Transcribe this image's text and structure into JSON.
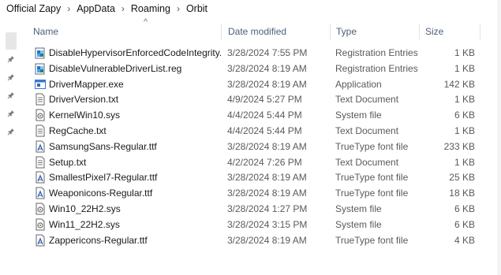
{
  "breadcrumb": [
    "Official Zapy",
    "AppData",
    "Roaming",
    "Orbit"
  ],
  "breadcrumb_separator": "›",
  "columns": {
    "name": "Name",
    "date": "Date modified",
    "type": "Type",
    "size": "Size",
    "sort_indicator": "^"
  },
  "files": [
    {
      "name": "DisableHypervisorEnforcedCodeIntegrity....",
      "date": "3/28/2024 7:55 PM",
      "type": "Registration Entries",
      "size": "1 KB",
      "icon": "registry-icon"
    },
    {
      "name": "DisableVulnerableDriverList.reg",
      "date": "3/28/2024 8:19 AM",
      "type": "Registration Entries",
      "size": "1 KB",
      "icon": "registry-icon"
    },
    {
      "name": "DriverMapper.exe",
      "date": "3/28/2024 8:19 AM",
      "type": "Application",
      "size": "142 KB",
      "icon": "application-icon"
    },
    {
      "name": "DriverVersion.txt",
      "date": "4/9/2024 5:27 PM",
      "type": "Text Document",
      "size": "1 KB",
      "icon": "text-document-icon"
    },
    {
      "name": "KernelWin10.sys",
      "date": "4/4/2024 5:44 PM",
      "type": "System file",
      "size": "6 KB",
      "icon": "system-file-icon"
    },
    {
      "name": "RegCache.txt",
      "date": "4/4/2024 5:44 PM",
      "type": "Text Document",
      "size": "1 KB",
      "icon": "text-document-icon"
    },
    {
      "name": "SamsungSans-Regular.ttf",
      "date": "3/28/2024 8:19 AM",
      "type": "TrueType font file",
      "size": "233 KB",
      "icon": "font-file-icon"
    },
    {
      "name": "Setup.txt",
      "date": "4/2/2024 7:26 PM",
      "type": "Text Document",
      "size": "1 KB",
      "icon": "text-document-icon"
    },
    {
      "name": "SmallestPixel7-Regular.ttf",
      "date": "3/28/2024 8:19 AM",
      "type": "TrueType font file",
      "size": "25 KB",
      "icon": "font-file-icon"
    },
    {
      "name": "Weaponicons-Regular.ttf",
      "date": "3/28/2024 8:19 AM",
      "type": "TrueType font file",
      "size": "18 KB",
      "icon": "font-file-icon"
    },
    {
      "name": "Win10_22H2.sys",
      "date": "3/28/2024 1:27 PM",
      "type": "System file",
      "size": "6 KB",
      "icon": "system-file-icon"
    },
    {
      "name": "Win11_22H2.sys",
      "date": "3/28/2024 3:15 PM",
      "type": "System file",
      "size": "6 KB",
      "icon": "system-file-icon"
    },
    {
      "name": "Zappericons-Regular.ttf",
      "date": "3/28/2024 8:19 AM",
      "type": "TrueType font file",
      "size": "4 KB",
      "icon": "font-file-icon"
    }
  ],
  "quick_access_pins": [
    "pin-icon",
    "pin-icon",
    "pin-icon",
    "pin-icon",
    "pin-icon"
  ],
  "colors": {
    "header_text": "#4c607a",
    "registry_accent": "#2b6fd6",
    "app_accent": "#3a78c9"
  }
}
